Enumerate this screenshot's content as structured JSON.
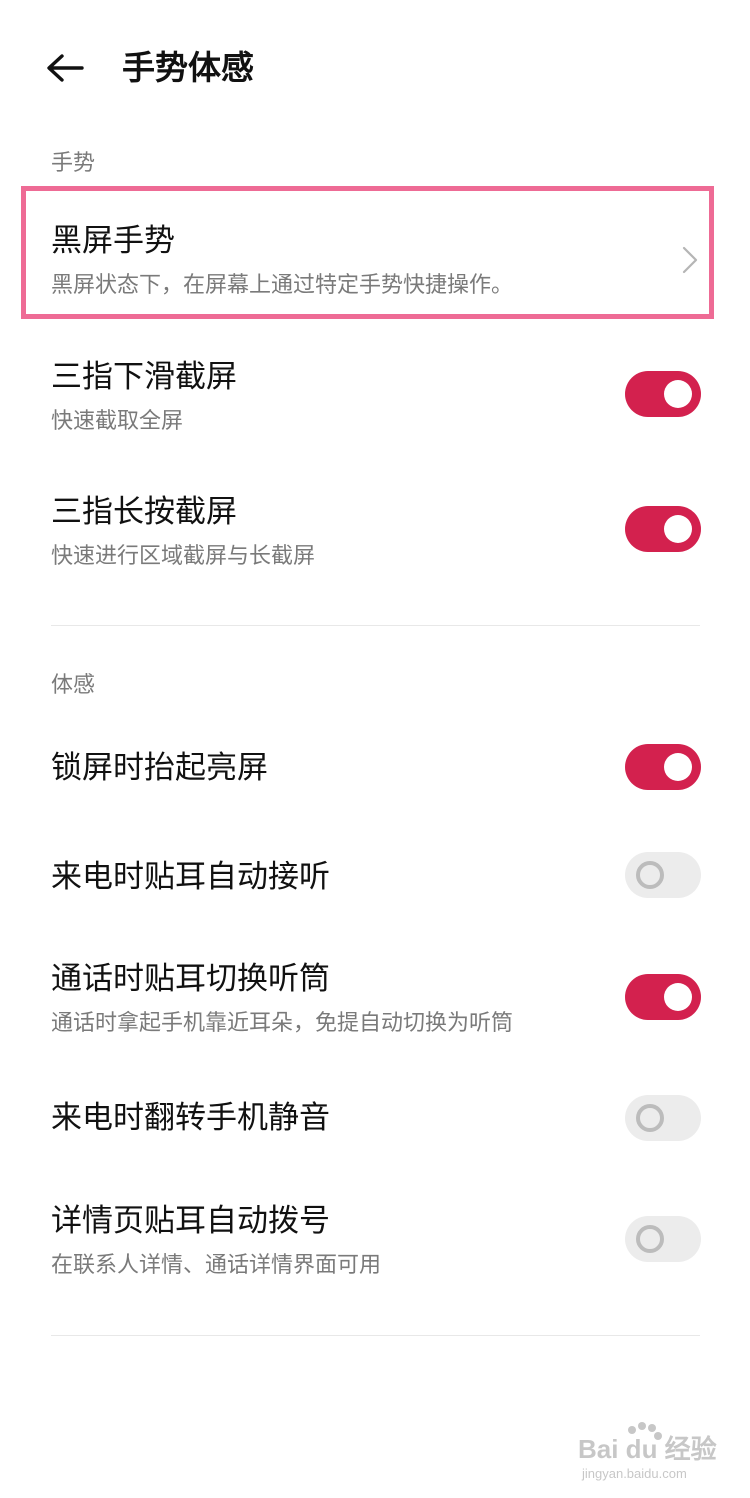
{
  "header": {
    "title": "手势体感",
    "back_icon": "arrow-left-icon"
  },
  "sections": [
    {
      "label": "手势",
      "items": [
        {
          "title": "黑屏手势",
          "subtitle": "黑屏状态下，在屏幕上通过特定手势快捷操作。",
          "control": "chevron",
          "highlighted": true
        },
        {
          "title": "三指下滑截屏",
          "subtitle": "快速截取全屏",
          "control": "toggle",
          "on": true
        },
        {
          "title": "三指长按截屏",
          "subtitle": "快速进行区域截屏与长截屏",
          "control": "toggle",
          "on": true
        }
      ]
    },
    {
      "label": "体感",
      "items": [
        {
          "title": "锁屏时抬起亮屏",
          "control": "toggle",
          "on": true
        },
        {
          "title": "来电时贴耳自动接听",
          "control": "toggle",
          "on": false
        },
        {
          "title": "通话时贴耳切换听筒",
          "subtitle": "通话时拿起手机靠近耳朵，免提自动切换为听筒",
          "control": "toggle",
          "on": true
        },
        {
          "title": "来电时翻转手机静音",
          "control": "toggle",
          "on": false
        },
        {
          "title": "详情页贴耳自动拨号",
          "subtitle": "在联系人详情、通话详情界面可用",
          "control": "toggle",
          "on": false
        }
      ]
    }
  ],
  "watermark": {
    "brand": "Bai du 经验",
    "url": "jingyan.baidu.com"
  },
  "colors": {
    "accent": "#d3214e",
    "highlight_border": "#ee6b95",
    "toggle_off": "#ececec",
    "secondary_text": "#7a7a7a"
  }
}
